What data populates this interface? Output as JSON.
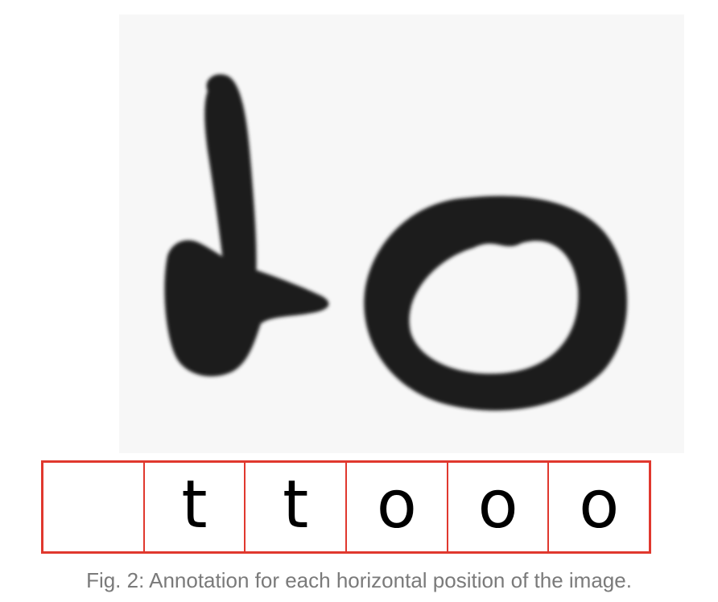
{
  "figure": {
    "image": {
      "icon": "handwritten-word-image",
      "ink_color": "#1f1f1f",
      "paper_color": "#f7f7f7"
    },
    "annotation": {
      "border_color": "#e0382e",
      "cells": [
        "",
        "t",
        "t",
        "o",
        "o",
        "o"
      ]
    },
    "caption": "Fig. 2: Annotation for each horizontal position of the image."
  }
}
